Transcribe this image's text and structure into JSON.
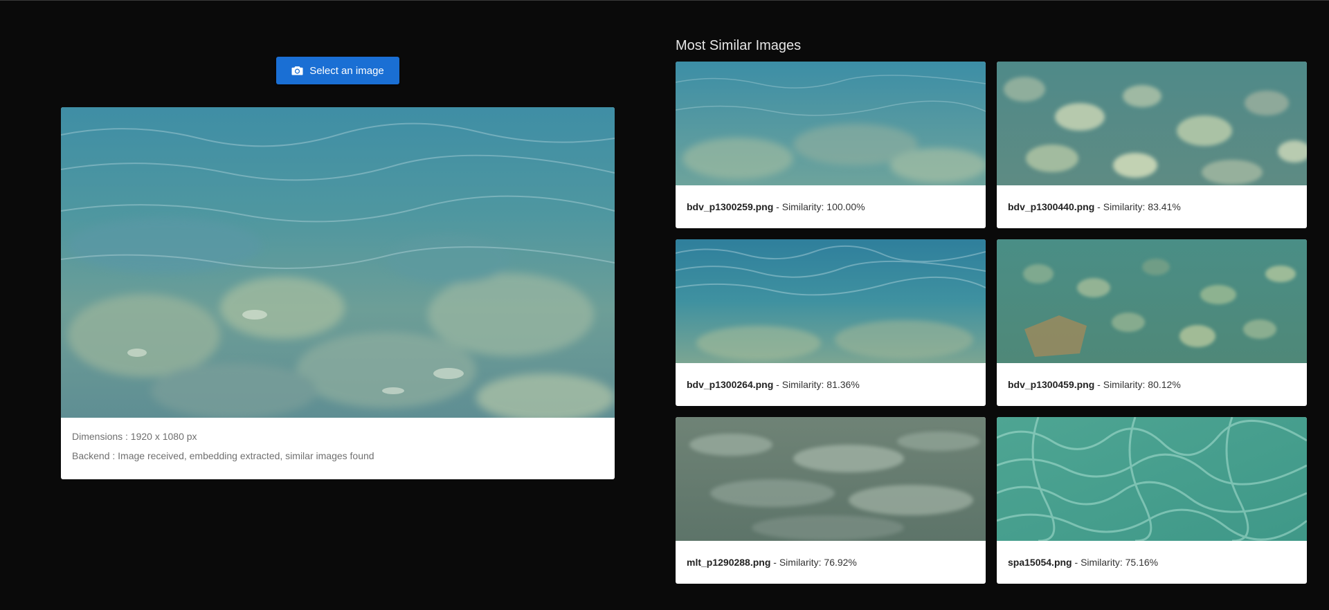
{
  "upload": {
    "button_label": "Select an image",
    "icon": "camera-icon",
    "accent_color": "#1a6fd4"
  },
  "query": {
    "dimensions_label": "Dimensions : 1920 x 1080 px",
    "backend_label": "Backend : Image received, embedding extracted, similar images found"
  },
  "results": {
    "title": "Most Similar Images",
    "separator": " - ",
    "items": [
      {
        "filename": "bdv_p1300259.png",
        "similarity": "Similarity: 100.00%"
      },
      {
        "filename": "bdv_p1300440.png",
        "similarity": "Similarity: 83.41%"
      },
      {
        "filename": "bdv_p1300264.png",
        "similarity": "Similarity: 81.36%"
      },
      {
        "filename": "bdv_p1300459.png",
        "similarity": "Similarity: 80.12%"
      },
      {
        "filename": "mlt_p1290288.png",
        "similarity": "Similarity: 76.92%"
      },
      {
        "filename": "spa15054.png",
        "similarity": "Similarity: 75.16%"
      }
    ]
  }
}
